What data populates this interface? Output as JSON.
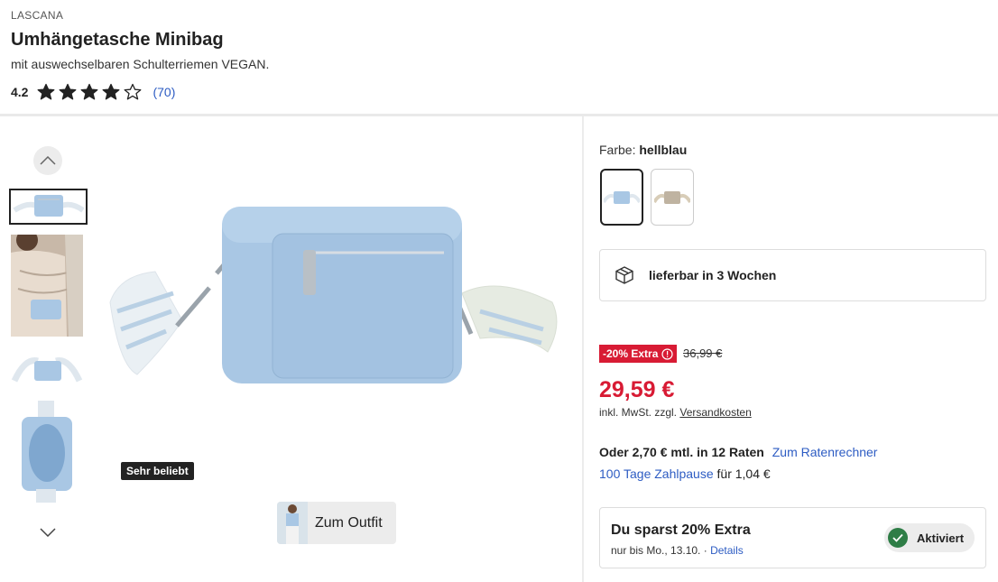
{
  "product": {
    "brand": "LASCANA",
    "title": "Umhängetasche Minibag",
    "subtitle": "mit auswechselbaren Schulterriemen VEGAN.",
    "rating_value": "4.2",
    "rating_stars": 4,
    "rating_count": "(70)"
  },
  "gallery": {
    "badge": "Sehr beliebt",
    "outfit_button": "Zum Outfit",
    "up_icon": "chevron-up-icon",
    "down_icon": "chevron-down-icon"
  },
  "color": {
    "label": "Farbe:",
    "selected": "hellblau",
    "swatch_colors": [
      "#a9c7e4",
      "#bfb3a1"
    ]
  },
  "delivery": {
    "icon": "package-icon",
    "text": "lieferbar in 3 Wochen"
  },
  "price": {
    "discount_badge": "-20% Extra",
    "old_price": "36,99 €",
    "current": "29,59 €",
    "tax_prefix": "inkl. MwSt. zzgl.",
    "tax_link": "Versandkosten"
  },
  "financing": {
    "installment": "Oder 2,70 € mtl. in 12 Raten",
    "calculator_link": "Zum Ratenrechner",
    "pause_link": "100 Tage Zahlpause",
    "pause_suffix": "für 1,04 €"
  },
  "savings": {
    "title": "Du sparst 20% Extra",
    "sub_prefix": "nur bis Mo., 13.10. ·",
    "details_link": "Details",
    "activated_label": "Aktiviert"
  },
  "colors": {
    "sale_red": "#d81b34",
    "link_blue": "#2d5cc3",
    "bag_blue": "#a9c7e4",
    "check_green": "#2e7d46"
  }
}
